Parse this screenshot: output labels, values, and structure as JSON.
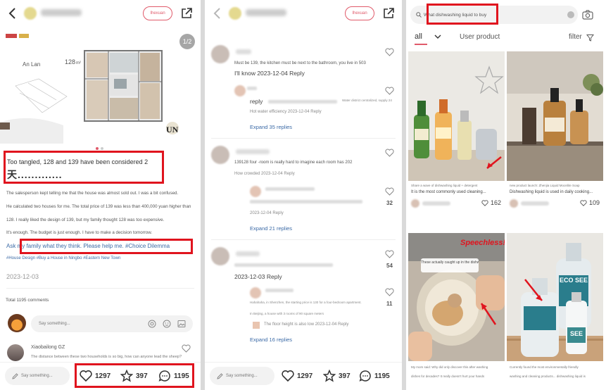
{
  "panel1": {
    "follow_label": "Ihexuan",
    "floorplan_brand": "An Lan",
    "floorplan_area": "128",
    "page_indicator": "1/2",
    "note_title": "Too tangled, 128 and 139 have been considered 2",
    "note_title_big": "天.............",
    "body1": "The salesperson kept telling me that the house was almost sold out. I was a bit confused.",
    "body2": "He calculated two houses for me. The total price of 139 was less than 400,000 yuan higher than",
    "body3": "128. I really liked the design of 139, but my family thought 128 was too expensive.",
    "body4": "It's enough. The budget is just enough. I have to make a decision tomorrow.",
    "tagline": "Ask my family what they think. Please help me. #Choice Dilemma",
    "hashtags": "#House Design #Buy a House in Ningbo #Eastern New Town",
    "date": "2023-12-03",
    "total_comments": "Total 1195 comments",
    "comment_placeholder": "Say something...",
    "comment_user": "Xiaobailong GZ",
    "comment_text": "The distance between these two households is so big, how can anyone lead the sheep?",
    "bottom_say": "Say something...",
    "likes": "1297",
    "stars": "397",
    "comments": "1195"
  },
  "panel2": {
    "follow_label": "Ihexuan",
    "c1_text": "Must be 139, the kitchen must be next to the bathroom, you live in 503",
    "c1_reply": "I'll know 2023-12-04 Reply",
    "c1_sub_reply_word": "reply",
    "c1_sub_right": "Water district centralized, supply 24",
    "c1_sub_meta": "Hot water efficiency 2023-12-04 Reply",
    "c1_expand": "Expand 35 replies",
    "c2_text": "139128 four -room is really hard to imagine each room has 202",
    "c2_meta": "How crowded 2023-12-04 Reply",
    "c2_sub_meta": "2023-12-04 Reply",
    "c2_count": "32",
    "c2_expand": "Expand 21 replies",
    "c3_date": "2023-12-03 Reply",
    "c3_count_a": "54",
    "c3_sub1": "Hahahaha, in Shenzhen, the starting price is 130 for a four-bedroom apartment.",
    "c3_sub2": "In Beijing, a house with 3 rooms of 90 square meters",
    "c3_sub3": "The floor height is also low 2023-12-04 Reply",
    "c3_count_b": "11",
    "c3_expand": "Expand 16 replies",
    "bottom_say": "Say something...",
    "likes": "1297",
    "stars": "397",
    "comments": "1195"
  },
  "panel3": {
    "search_value": "What dishwashing liquid to buy",
    "tab_all": "all",
    "tab_user": "User product",
    "filter": "filter",
    "cards": [
      {
        "sub": "Share a wave of dishwashing liquid + detergent",
        "title": "It is the most commonly used cleaning...",
        "likes": "162"
      },
      {
        "sub": "new product launch: Zhenjia Liquid Moonlite Soap",
        "title": "Dishwashing liquid is used in daily cooking...",
        "likes": "109"
      },
      {
        "sub": "My mom said: Why did only discover this after washing",
        "title": "dishes for decades? It really doesn't hurt your hands",
        "likes": ""
      },
      {
        "sub": "Currently found the most environmentally friendly",
        "title": "washing and cleaning products... dishwashing liquid is",
        "likes": ""
      }
    ],
    "card3_banner": "Speechless!",
    "card3_caption": "These actually caught up in the dishwashing liquid",
    "card4_label_top": "ECO SEE",
    "card4_label_bottom": "SEE"
  },
  "colors": {
    "accent": "#e05a6a",
    "highlight": "#e0141e",
    "link": "#3b6aa6"
  }
}
